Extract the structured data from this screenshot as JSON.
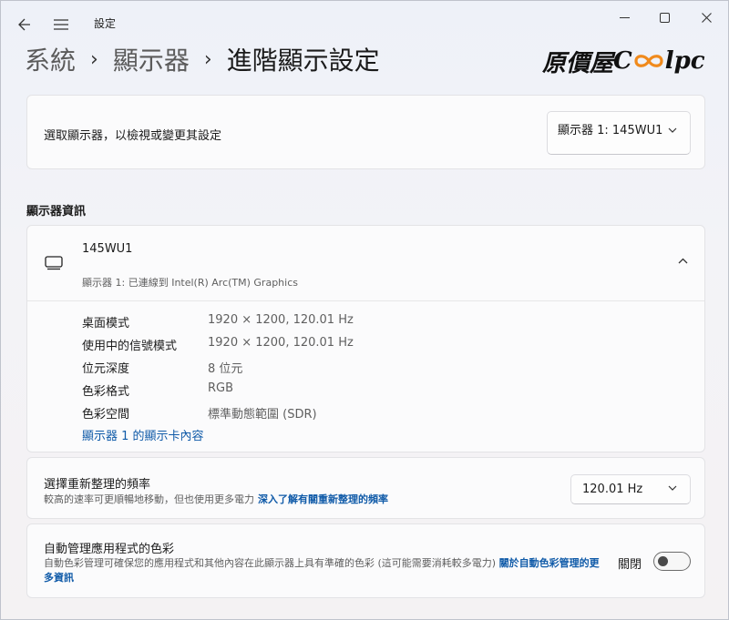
{
  "titlebar": {
    "app_title": "設定"
  },
  "breadcrumb": {
    "items": [
      "系統",
      "顯示器",
      "進階顯示設定"
    ],
    "separator": "›"
  },
  "logo": {
    "prefix": "原價屋",
    "c": "C",
    "o_symbol": "∞",
    "suffix": "lpc"
  },
  "display_select": {
    "label": "選取顯示器，以檢視或變更其設定",
    "selected": "顯示器 1: 145WU1"
  },
  "display_info": {
    "heading": "顯示器資訊",
    "monitor_name": "145WU1",
    "monitor_sub": "顯示器 1: 已連線到 Intel(R) Arc(TM) Graphics",
    "rows": [
      {
        "key": "桌面模式",
        "value": "1920 × 1200, 120.01 Hz"
      },
      {
        "key": "使用中的信號模式",
        "value": "1920 × 1200, 120.01 Hz"
      },
      {
        "key": "位元深度",
        "value": "8 位元"
      },
      {
        "key": "色彩格式",
        "value": "RGB"
      },
      {
        "key": "色彩空間",
        "value": "標準動態範圍 (SDR)"
      }
    ],
    "adapter_link": "顯示器 1 的顯示卡內容"
  },
  "refresh_rate": {
    "title": "選擇重新整理的頻率",
    "description": "較高的速率可更順暢地移動，但也使用更多電力",
    "link": "深入了解有關重新整理的頻率",
    "selected": "120.01 Hz"
  },
  "color_management": {
    "title": "自動管理應用程式的色彩",
    "description": "自動色彩管理可確保您的應用程式和其他內容在此顯示器上具有準確的色彩 (這可能需要消耗較多電力)",
    "link": "關於自動色彩管理的更多資訊",
    "toggle_label": "關閉",
    "toggle_on": false
  },
  "colors": {
    "accent_link": "#0f5aa8",
    "logo_orange": "#f08a1c"
  }
}
